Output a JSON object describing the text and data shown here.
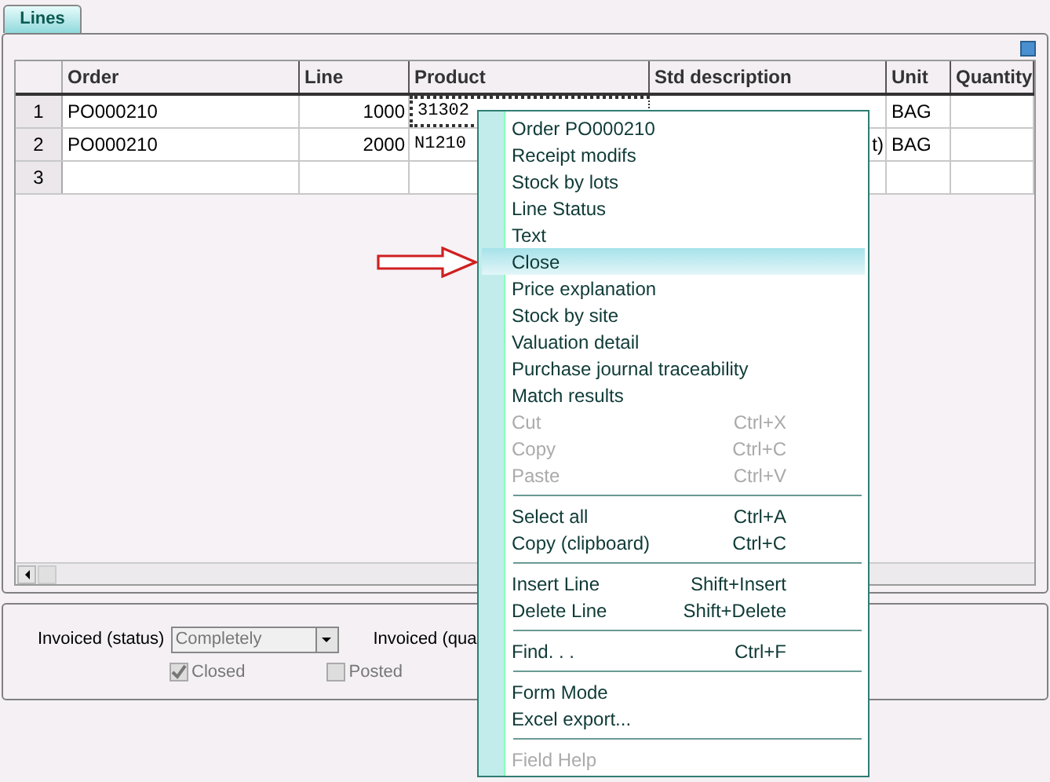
{
  "tabs": [
    {
      "label": "Lines",
      "selected": true
    }
  ],
  "table": {
    "columns": [
      "Order",
      "Line",
      "Product",
      "Std description",
      "Unit",
      "Quantity"
    ],
    "rows": [
      {
        "number": "1",
        "cells": [
          "PO000210",
          "1000",
          "31302",
          "",
          "BAG",
          ""
        ],
        "focused": true
      },
      {
        "number": "2",
        "cells": [
          "PO000210",
          "2000",
          "N1210",
          "t)",
          "BAG",
          ""
        ],
        "focused": false
      },
      {
        "number": "3",
        "cells": [
          "",
          "",
          "",
          "",
          "",
          ""
        ],
        "focused": false
      }
    ]
  },
  "form": {
    "status_label": "Invoiced (status)",
    "status_value": "Completely",
    "quantity_label": "Invoiced (qua",
    "checkboxes": [
      {
        "label": "Closed",
        "checked": true
      },
      {
        "label": "Posted",
        "checked": false
      }
    ]
  },
  "context_menu": {
    "items": [
      {
        "kind": "item",
        "label": "Order PO000210",
        "disabled": false,
        "selected": false
      },
      {
        "kind": "item",
        "label": "Receipt modifs",
        "disabled": false,
        "selected": false
      },
      {
        "kind": "item",
        "label": "Stock by lots",
        "disabled": false,
        "selected": false
      },
      {
        "kind": "item",
        "label": "Line Status",
        "disabled": false,
        "selected": false
      },
      {
        "kind": "item",
        "label": "Text",
        "disabled": false,
        "selected": false
      },
      {
        "kind": "item",
        "label": "Close",
        "disabled": false,
        "selected": true
      },
      {
        "kind": "item",
        "label": "Price explanation",
        "disabled": false,
        "selected": false
      },
      {
        "kind": "item",
        "label": "Stock by site",
        "disabled": false,
        "selected": false
      },
      {
        "kind": "item",
        "label": "Valuation detail",
        "disabled": false,
        "selected": false
      },
      {
        "kind": "item",
        "label": "Purchase journal traceability",
        "disabled": false,
        "selected": false
      },
      {
        "kind": "item",
        "label": "Match results",
        "disabled": false,
        "selected": false
      },
      {
        "kind": "item",
        "label": "Cut",
        "shortcut": "Ctrl+X",
        "disabled": true,
        "selected": false
      },
      {
        "kind": "item",
        "label": "Copy",
        "shortcut": "Ctrl+C",
        "disabled": true,
        "selected": false
      },
      {
        "kind": "item",
        "label": "Paste",
        "shortcut": "Ctrl+V",
        "disabled": true,
        "selected": false
      },
      {
        "kind": "separator"
      },
      {
        "kind": "item",
        "label": "Select all",
        "shortcut": "Ctrl+A",
        "disabled": false,
        "selected": false
      },
      {
        "kind": "item",
        "label": "Copy (clipboard)",
        "shortcut": "Ctrl+C",
        "disabled": false,
        "selected": false
      },
      {
        "kind": "separator"
      },
      {
        "kind": "item",
        "label": "Insert Line",
        "shortcut": "Shift+Insert",
        "disabled": false,
        "selected": false
      },
      {
        "kind": "item",
        "label": "Delete Line",
        "shortcut": "Shift+Delete",
        "disabled": false,
        "selected": false
      },
      {
        "kind": "separator"
      },
      {
        "kind": "item",
        "label": "Find. . .",
        "shortcut": "Ctrl+F",
        "disabled": false,
        "selected": false
      },
      {
        "kind": "separator"
      },
      {
        "kind": "item",
        "label": "Form Mode",
        "disabled": false,
        "selected": false
      },
      {
        "kind": "item",
        "label": "Excel export...",
        "disabled": false,
        "selected": false
      },
      {
        "kind": "separator"
      },
      {
        "kind": "item",
        "label": "Field Help",
        "disabled": true,
        "selected": false
      }
    ]
  }
}
